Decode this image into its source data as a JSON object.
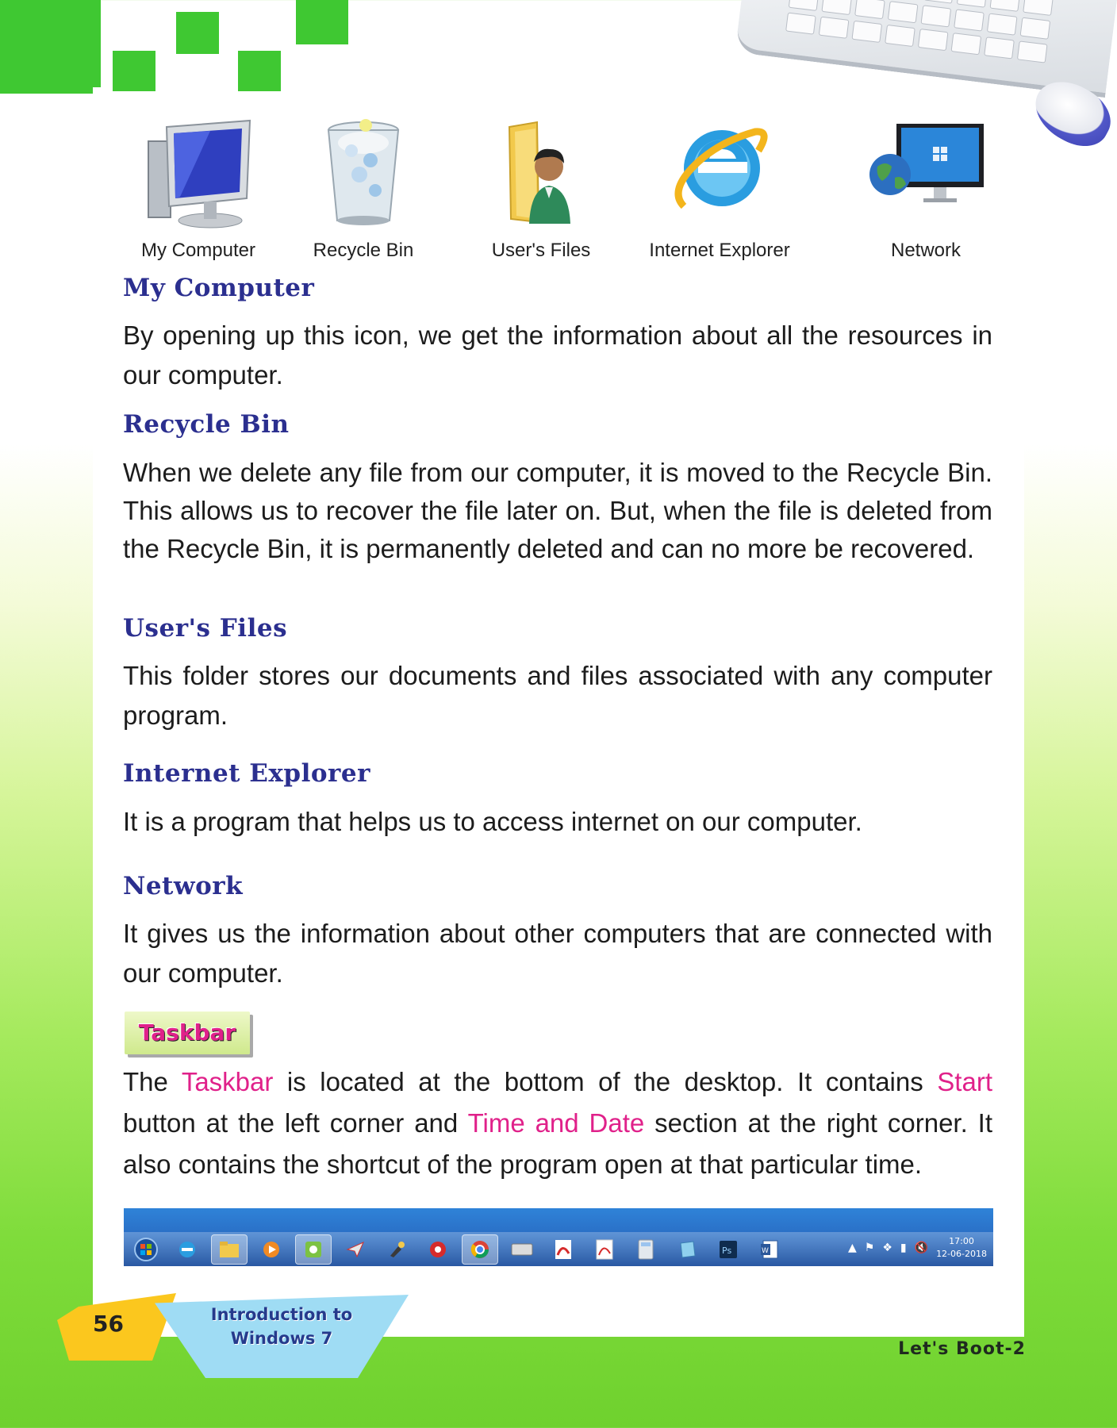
{
  "icons": [
    {
      "label": "My Computer",
      "icon": "computer-icon"
    },
    {
      "label": "Recycle Bin",
      "icon": "recycle-bin-icon"
    },
    {
      "label": "User's Files",
      "icon": "user-folder-icon"
    },
    {
      "label": "Internet Explorer",
      "icon": "internet-explorer-icon"
    },
    {
      "label": "Network",
      "icon": "network-icon"
    }
  ],
  "sections": {
    "my_computer": {
      "heading": "My Computer",
      "text": "By opening up this icon, we get the information about all the resources in our computer."
    },
    "recycle_bin": {
      "heading": "Recycle Bin",
      "text": "When we delete any file from our computer, it is moved to the Recycle Bin. This allows us to recover the file later on. But, when the file is deleted from the Recycle Bin, it is permanently deleted and can no more be recovered."
    },
    "users_files": {
      "heading": "User's Files",
      "text": "This folder stores our documents and files associated with any computer program."
    },
    "internet_explorer": {
      "heading": "Internet Explorer",
      "text": "It is a program that helps us to access internet on our computer."
    },
    "network": {
      "heading": "Network",
      "text": "It gives us the information about other computers that are connected with our computer."
    }
  },
  "taskbar_section": {
    "tag": "Taskbar",
    "p_the": "The ",
    "hl_taskbar": "Taskbar",
    "p_mid1": " is located at the bottom of the desktop. It contains ",
    "hl_start": "Start",
    "p_mid2": " button at the left corner and ",
    "hl_time": "Time and Date",
    "p_end": " section at the right corner. It also contains the shortcut of the program open at that particular time."
  },
  "windows_taskbar": {
    "time": "17:00",
    "date": "12-06-2018"
  },
  "footer": {
    "page_number": "56",
    "chapter_line1": "Introduction to",
    "chapter_line2": "Windows 7",
    "book_name": "Let's Boot-2"
  },
  "colors": {
    "heading": "#2b2f8f",
    "highlight": "#e0218a",
    "green": "#3fc832"
  }
}
